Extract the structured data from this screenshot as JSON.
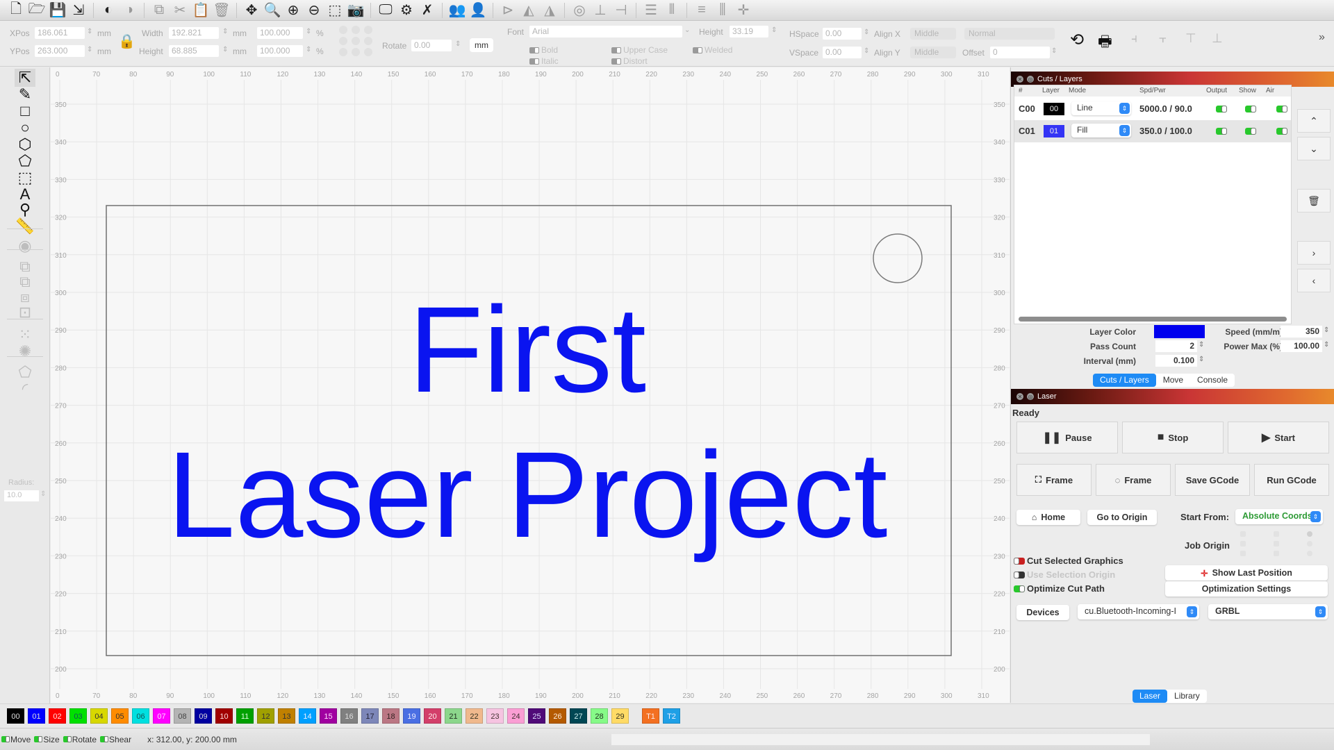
{
  "toolbar": {
    "icons": [
      {
        "name": "new-file-icon",
        "glyph": "🗋",
        "enabled": true
      },
      {
        "name": "open-folder-icon",
        "glyph": "🗁",
        "enabled": true
      },
      {
        "name": "save-icon",
        "glyph": "💾",
        "enabled": true
      },
      {
        "name": "export-icon",
        "glyph": "⇲",
        "enabled": true
      },
      {
        "sep": true
      },
      {
        "name": "undo-icon",
        "glyph": "◐",
        "enabled": true
      },
      {
        "name": "redo-icon",
        "glyph": "◑",
        "enabled": false
      },
      {
        "sep": true
      },
      {
        "name": "copy-icon",
        "glyph": "⧉",
        "enabled": false
      },
      {
        "name": "cut-icon",
        "glyph": "✂",
        "enabled": false
      },
      {
        "name": "paste-icon",
        "glyph": "📋",
        "enabled": false
      },
      {
        "name": "delete-icon",
        "glyph": "🗑",
        "enabled": false
      },
      {
        "sep": true
      },
      {
        "name": "pan-icon",
        "glyph": "✥",
        "enabled": true
      },
      {
        "name": "zoom-fit-icon",
        "glyph": "🔍",
        "enabled": true
      },
      {
        "name": "zoom-in-icon",
        "glyph": "⊕",
        "enabled": true
      },
      {
        "name": "zoom-out-icon",
        "glyph": "⊖",
        "enabled": true
      },
      {
        "name": "zoom-selection-icon",
        "glyph": "⬚",
        "enabled": true
      },
      {
        "name": "camera-icon",
        "glyph": "📷",
        "enabled": false
      },
      {
        "sep": true
      },
      {
        "name": "monitor-icon",
        "glyph": "🖵",
        "enabled": true
      },
      {
        "name": "settings-gears-icon",
        "glyph": "⚙",
        "enabled": true
      },
      {
        "name": "tools-icon",
        "glyph": "✗",
        "enabled": true
      },
      {
        "sep": true
      },
      {
        "name": "group-icon",
        "glyph": "👥",
        "enabled": false
      },
      {
        "name": "ungroup-icon",
        "glyph": "👤",
        "enabled": false
      },
      {
        "sep": true
      },
      {
        "name": "flip-horizontal-icon",
        "glyph": "⊳",
        "enabled": false
      },
      {
        "name": "mirror-icon",
        "glyph": "◭",
        "enabled": false
      },
      {
        "name": "rotate-icon",
        "glyph": "◮",
        "enabled": false
      },
      {
        "sep": true
      },
      {
        "name": "target-icon",
        "glyph": "◎",
        "enabled": false
      },
      {
        "name": "align-bottom-icon",
        "glyph": "⊥",
        "enabled": false
      },
      {
        "name": "align-right-icon",
        "glyph": "⊣",
        "enabled": false
      },
      {
        "sep": true
      },
      {
        "name": "distribute-vertical-icon",
        "glyph": "☰",
        "enabled": false
      },
      {
        "name": "distribute-horizontal-icon",
        "glyph": "⫴",
        "enabled": false
      },
      {
        "sep": true
      },
      {
        "name": "space-vertical-icon",
        "glyph": "≡",
        "enabled": false
      },
      {
        "name": "space-horizontal-icon",
        "glyph": "⫼",
        "enabled": false
      },
      {
        "name": "move-to-origin-icon",
        "glyph": "✛",
        "enabled": false
      }
    ]
  },
  "props": {
    "xpos_label": "XPos",
    "xpos_value": "186.061",
    "ypos_label": "YPos",
    "ypos_value": "263.000",
    "unit_mm": "mm",
    "unit_pct": "%",
    "width_label": "Width",
    "width_value": "192.821",
    "height_label": "Height",
    "height_value": "68.885",
    "width_pct": "100.000",
    "height_pct": "100.000",
    "rotate_label": "Rotate",
    "rotate_value": "0.00",
    "unit_button": "mm",
    "font_label": "Font",
    "font_value": "Arial",
    "text_height_label": "Height",
    "text_height_value": "33.19",
    "hspace_label": "HSpace",
    "hspace_value": "0.00",
    "vspace_label": "VSpace",
    "vspace_value": "0.00",
    "alignx_label": "Align X",
    "alignx_value": "Middle",
    "aligny_label": "Align Y",
    "aligny_value": "Middle",
    "style_value": "Normal",
    "offset_label": "Offset",
    "offset_value": "0",
    "bold": "Bold",
    "italic": "Italic",
    "upper_case": "Upper Case",
    "distort": "Distort",
    "welded": "Welded"
  },
  "left_tools": {
    "items": [
      {
        "name": "select-tool-icon",
        "glyph": "⇱",
        "enabled": true
      },
      {
        "name": "pencil-tool-icon",
        "glyph": "✎",
        "enabled": true
      },
      {
        "name": "rectangle-tool-icon",
        "glyph": "□",
        "enabled": true
      },
      {
        "name": "ellipse-tool-icon",
        "glyph": "○",
        "enabled": true
      },
      {
        "name": "polygon-tool-icon",
        "glyph": "⬡",
        "enabled": true
      },
      {
        "name": "pentagon-tool-icon",
        "glyph": "⬠",
        "enabled": true
      },
      {
        "name": "position-laser-tool-icon",
        "glyph": "⬚",
        "enabled": true
      },
      {
        "name": "text-tool-icon",
        "glyph": "A",
        "enabled": true
      },
      {
        "name": "marker-tool-icon",
        "glyph": "⚲",
        "enabled": true
      },
      {
        "name": "measure-tool-icon",
        "glyph": "📏",
        "enabled": true
      },
      {
        "name": "offset-tool-icon",
        "glyph": "◉",
        "enabled": false
      },
      {
        "name": "weld-tool-icon",
        "glyph": "⧉",
        "enabled": false
      },
      {
        "name": "boolean-union-icon",
        "glyph": "⧉",
        "enabled": false
      },
      {
        "name": "boolean-subtract-icon",
        "glyph": "⧈",
        "enabled": false
      },
      {
        "name": "boolean-intersect-icon",
        "glyph": "⊡",
        "enabled": false
      },
      {
        "name": "grid-array-icon",
        "glyph": "⁙",
        "enabled": false
      },
      {
        "name": "circular-array-icon",
        "glyph": "✺",
        "enabled": false
      },
      {
        "name": "node-edit-icon",
        "glyph": "⬠",
        "enabled": false
      },
      {
        "name": "corner-radius-icon",
        "glyph": "◜",
        "enabled": false
      }
    ],
    "radius_label": "Radius:",
    "radius_value": "10.0"
  },
  "canvas": {
    "x_ticks": [
      "0",
      "70",
      "80",
      "90",
      "100",
      "110",
      "120",
      "130",
      "140",
      "150",
      "160",
      "170",
      "180",
      "190",
      "200",
      "210",
      "220",
      "230",
      "240",
      "250",
      "260",
      "270",
      "280",
      "290",
      "300",
      "310"
    ],
    "y_ticks": [
      "350",
      "340",
      "330",
      "320",
      "310",
      "300",
      "290",
      "280",
      "270",
      "260",
      "250",
      "240",
      "230",
      "220",
      "210",
      "200"
    ],
    "text_line1": "First",
    "text_line2": "Laser Project",
    "text_color": "#0a14f0"
  },
  "cuts_layers": {
    "title": "Cuts / Layers",
    "headers": [
      "#",
      "Layer",
      "Mode",
      "Spd/Pwr",
      "Output",
      "Show",
      "Air"
    ],
    "rows": [
      {
        "id": "C00",
        "layer": "00",
        "color": "#000000",
        "mode": "Line",
        "spd_pwr": "5000.0 / 90.0",
        "output": true,
        "show": true,
        "air": true
      },
      {
        "id": "C01",
        "layer": "01",
        "color": "#3434f5",
        "mode": "Fill",
        "spd_pwr": "350.0 / 100.0",
        "output": true,
        "show": true,
        "air": true
      }
    ],
    "layer_color_label": "Layer Color",
    "layer_color": "#0000ee",
    "speed_label": "Speed (mm/m)",
    "speed_value": "350",
    "pass_label": "Pass Count",
    "pass_value": "2",
    "power_label": "Power Max (%)",
    "power_value": "100.00",
    "interval_label": "Interval (mm)",
    "interval_value": "0.100",
    "tabs": [
      "Cuts / Layers",
      "Move",
      "Console"
    ],
    "active_tab": "Cuts / Layers"
  },
  "laser": {
    "title": "Laser",
    "status": "Ready",
    "pause": "Pause",
    "stop": "Stop",
    "start": "Start",
    "frame_rect": "Frame",
    "frame_circle": "Frame",
    "save_gcode": "Save GCode",
    "run_gcode": "Run GCode",
    "home": "Home",
    "go_to_origin": "Go to Origin",
    "start_from_label": "Start From:",
    "start_from_value": "Absolute Coords",
    "job_origin_label": "Job Origin",
    "cut_selected": "Cut Selected Graphics",
    "use_selection_origin": "Use Selection Origin",
    "optimize_cut_path": "Optimize Cut Path",
    "show_last_position": "Show Last Position",
    "optimization_settings": "Optimization Settings",
    "devices": "Devices",
    "port_value": "cu.Bluetooth-Incoming-I",
    "controller_value": "GRBL",
    "bottom_tabs": [
      "Laser",
      "Library"
    ],
    "active_bottom_tab": "Laser"
  },
  "palette": [
    {
      "label": "00",
      "color": "#000000",
      "text": "#ddd"
    },
    {
      "label": "01",
      "color": "#0000ff",
      "text": "#ddd"
    },
    {
      "label": "02",
      "color": "#ff0000",
      "text": "#fdd"
    },
    {
      "label": "03",
      "color": "#00e000",
      "text": "#155"
    },
    {
      "label": "04",
      "color": "#d8d800",
      "text": "#333"
    },
    {
      "label": "05",
      "color": "#ff8c00",
      "text": "#333"
    },
    {
      "label": "06",
      "color": "#00e0e0",
      "text": "#155"
    },
    {
      "label": "07",
      "color": "#ff00ff",
      "text": "#fdf"
    },
    {
      "label": "08",
      "color": "#b4b4b4",
      "text": "#444"
    },
    {
      "label": "09",
      "color": "#0000a0",
      "text": "#ddd"
    },
    {
      "label": "10",
      "color": "#a00000",
      "text": "#fdd"
    },
    {
      "label": "11",
      "color": "#00a000",
      "text": "#dfd"
    },
    {
      "label": "12",
      "color": "#a0a000",
      "text": "#333"
    },
    {
      "label": "13",
      "color": "#c08000",
      "text": "#333"
    },
    {
      "label": "14",
      "color": "#00a0ff",
      "text": "#eef"
    },
    {
      "label": "15",
      "color": "#a000a0",
      "text": "#fdf"
    },
    {
      "label": "16",
      "color": "#808080",
      "text": "#ddd"
    },
    {
      "label": "17",
      "color": "#7d87b9",
      "text": "#223"
    },
    {
      "label": "18",
      "color": "#bb7784",
      "text": "#322"
    },
    {
      "label": "19",
      "color": "#4a6fe3",
      "text": "#eef"
    },
    {
      "label": "20",
      "color": "#d33f6a",
      "text": "#fee"
    },
    {
      "label": "21",
      "color": "#8cd78c",
      "text": "#232"
    },
    {
      "label": "22",
      "color": "#f0b98d",
      "text": "#332"
    },
    {
      "label": "23",
      "color": "#f6c4e1",
      "text": "#433"
    },
    {
      "label": "24",
      "color": "#fa9ed4",
      "text": "#433"
    },
    {
      "label": "25",
      "color": "#500a78",
      "text": "#ddf"
    },
    {
      "label": "26",
      "color": "#b45a00",
      "text": "#fed"
    },
    {
      "label": "27",
      "color": "#004754",
      "text": "#cee"
    },
    {
      "label": "28",
      "color": "#86fa88",
      "text": "#232"
    },
    {
      "label": "29",
      "color": "#ffdb66",
      "text": "#332"
    },
    {
      "label": "T1",
      "color": "#f37021",
      "text": "#fee"
    },
    {
      "label": "T2",
      "color": "#1ea0e6",
      "text": "#eef"
    }
  ],
  "status": {
    "move": "Move",
    "size": "Size",
    "rotate": "Rotate",
    "shear": "Shear",
    "coords": "x: 312.00, y: 200.00 mm"
  }
}
